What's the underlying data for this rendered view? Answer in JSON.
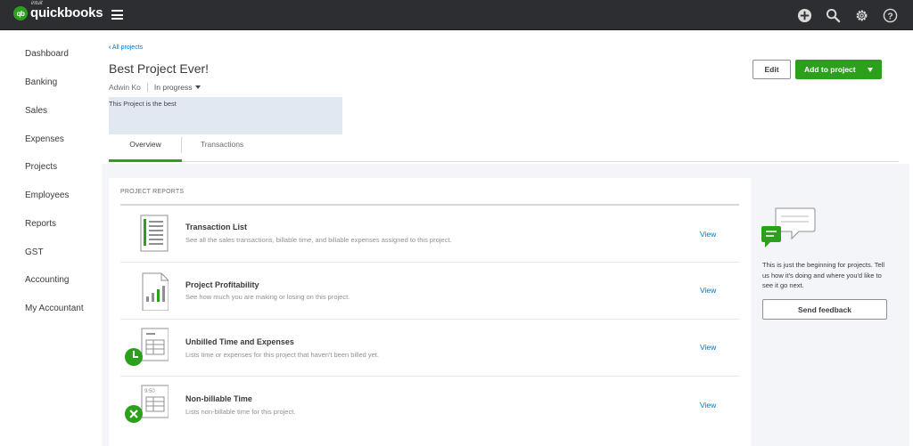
{
  "brand": {
    "intuit": "intuit",
    "name": "quickbooks",
    "badge": "qb"
  },
  "sidebar": {
    "items": [
      {
        "label": "Dashboard"
      },
      {
        "label": "Banking"
      },
      {
        "label": "Sales"
      },
      {
        "label": "Expenses"
      },
      {
        "label": "Projects"
      },
      {
        "label": "Employees"
      },
      {
        "label": "Reports"
      },
      {
        "label": "GST"
      },
      {
        "label": "Accounting"
      },
      {
        "label": "My Accountant"
      }
    ]
  },
  "project": {
    "back_link": "All projects",
    "title": "Best Project Ever!",
    "customer": "Adwin Ko",
    "status": "In progress",
    "description": "This Project is the best",
    "edit_label": "Edit",
    "add_label": "Add to project"
  },
  "tabs": [
    {
      "label": "Overview",
      "active": true
    },
    {
      "label": "Transactions",
      "active": false
    }
  ],
  "reports": {
    "heading": "PROJECT REPORTS",
    "items": [
      {
        "title": "Transaction List",
        "description": "See all the sales transactions, billable time, and billable expenses assigned to this project.",
        "view": "View",
        "icon": "transaction-list-icon"
      },
      {
        "title": "Project Profitability",
        "description": "See how much you are making or losing on this project.",
        "view": "View",
        "icon": "profitability-chart-icon"
      },
      {
        "title": "Unbilled Time and Expenses",
        "description": "Lists time or expenses for this project that haven't been billed yet.",
        "view": "View",
        "icon": "unbilled-clock-icon"
      },
      {
        "title": "Non-billable Time",
        "description": "Lists non-billable time for this project.",
        "view": "View",
        "icon": "non-billable-icon",
        "icon_time": "9:50"
      }
    ]
  },
  "feedback": {
    "text": "This is just the beginning for projects. Tell us how it's doing and where you'd like to see it go next.",
    "button": "Send feedback"
  },
  "colors": {
    "brand_green": "#2ca01c",
    "link_blue": "#0077c5",
    "topbar": "#2d2e31"
  }
}
